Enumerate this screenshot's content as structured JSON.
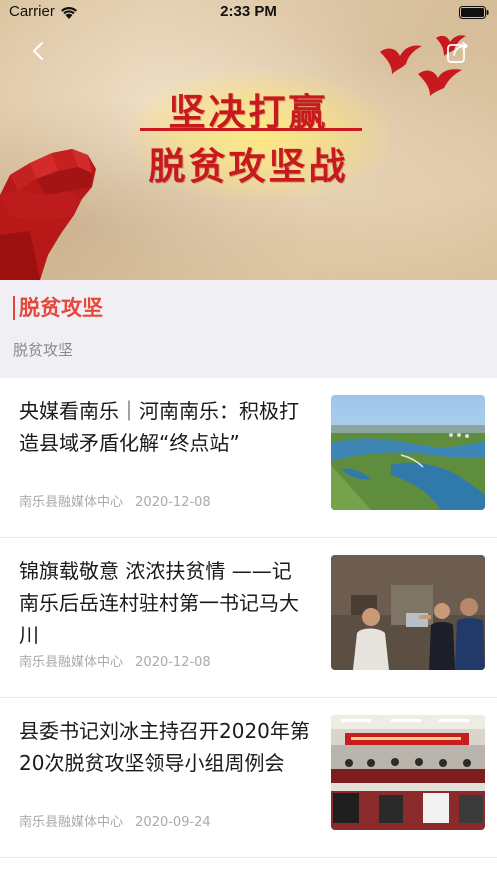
{
  "status_bar": {
    "carrier": "Carrier",
    "time": "2:33 PM"
  },
  "banner": {
    "line1": "坚决打赢",
    "line2": "脱贫攻坚战",
    "accent_color": "#c8191e"
  },
  "nav": {
    "back_icon": "chevron-left-icon",
    "share_icon": "share-icon"
  },
  "section": {
    "title": "脱贫攻坚",
    "subtitle": "脱贫攻坚",
    "accent_color": "#e8463a"
  },
  "news": [
    {
      "title": "央媒看南乐｜河南南乐：积极打造县域矛盾化解“终点站”",
      "source": "南乐县融媒体中心",
      "date": "2020-12-08",
      "thumb": "aerial-lake-photo"
    },
    {
      "title": "锦旗载敬意 浓浓扶贫情 ——记南乐后岳连村驻村第一书记马大川",
      "source": "南乐县融媒体中心",
      "date": "2020-12-08",
      "thumb": "people-indoor-photo"
    },
    {
      "title": "县委书记刘冰主持召开2020年第20次脱贫攻坚领导小组周例会",
      "source": "南乐县融媒体中心",
      "date": "2020-09-24",
      "thumb": "meeting-room-photo"
    }
  ]
}
